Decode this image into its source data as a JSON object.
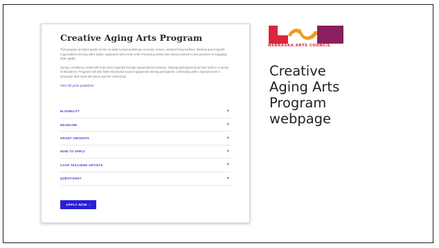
{
  "webpage": {
    "title": "Creative Aging Arts Program",
    "paragraphs": [
      "This program provides grants to hire an artist to lead workshops at senior centers, assisted living facilities, libraries and nonprofit organizations serving older adults. Applicants select from a list of teaching artists (see below) trained in best practices of engaging older adults.",
      "During a residency, artists will share their expertise through sequential arts lessons, helping participants hone their skills in a variety of disciplines. Programs will also foster intentional social engagement among participants, culminating with a special event to showcase their work with peers and the community."
    ],
    "guidelines_link": "View full grant guidelines.",
    "accordion": [
      {
        "label": "ELIGIBILITY"
      },
      {
        "label": "DEADLINE"
      },
      {
        "label": "GRANT AMOUNTS"
      },
      {
        "label": "HOW TO APPLY"
      },
      {
        "label": "CAAP TEACHING ARTISTS"
      },
      {
        "label": "QUESTIONS?"
      }
    ],
    "expand_symbol": "+",
    "apply_button": "APPLY NOW",
    "apply_arrow": "›"
  },
  "logo": {
    "text": "NEBRASKA ARTS COUNCIL",
    "colors": {
      "red": "#d7263d",
      "orange": "#f29a1e",
      "purple": "#8a1f5f"
    }
  },
  "caption": [
    "Creative",
    "Aging Arts",
    "Program",
    "webpage"
  ]
}
